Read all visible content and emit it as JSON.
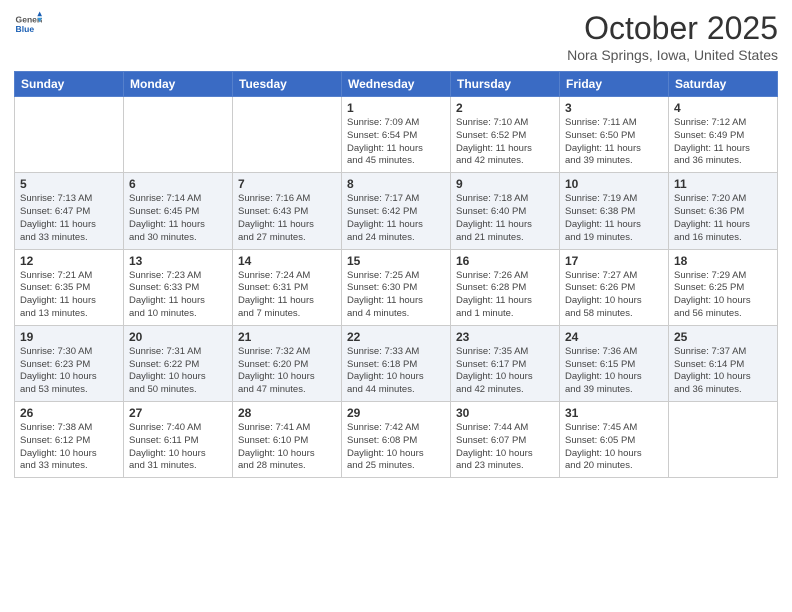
{
  "header": {
    "logo_general": "General",
    "logo_blue": "Blue",
    "month_title": "October 2025",
    "location": "Nora Springs, Iowa, United States"
  },
  "weekdays": [
    "Sunday",
    "Monday",
    "Tuesday",
    "Wednesday",
    "Thursday",
    "Friday",
    "Saturday"
  ],
  "weeks": [
    [
      {
        "day": "",
        "info": ""
      },
      {
        "day": "",
        "info": ""
      },
      {
        "day": "",
        "info": ""
      },
      {
        "day": "1",
        "info": "Sunrise: 7:09 AM\nSunset: 6:54 PM\nDaylight: 11 hours\nand 45 minutes."
      },
      {
        "day": "2",
        "info": "Sunrise: 7:10 AM\nSunset: 6:52 PM\nDaylight: 11 hours\nand 42 minutes."
      },
      {
        "day": "3",
        "info": "Sunrise: 7:11 AM\nSunset: 6:50 PM\nDaylight: 11 hours\nand 39 minutes."
      },
      {
        "day": "4",
        "info": "Sunrise: 7:12 AM\nSunset: 6:49 PM\nDaylight: 11 hours\nand 36 minutes."
      }
    ],
    [
      {
        "day": "5",
        "info": "Sunrise: 7:13 AM\nSunset: 6:47 PM\nDaylight: 11 hours\nand 33 minutes."
      },
      {
        "day": "6",
        "info": "Sunrise: 7:14 AM\nSunset: 6:45 PM\nDaylight: 11 hours\nand 30 minutes."
      },
      {
        "day": "7",
        "info": "Sunrise: 7:16 AM\nSunset: 6:43 PM\nDaylight: 11 hours\nand 27 minutes."
      },
      {
        "day": "8",
        "info": "Sunrise: 7:17 AM\nSunset: 6:42 PM\nDaylight: 11 hours\nand 24 minutes."
      },
      {
        "day": "9",
        "info": "Sunrise: 7:18 AM\nSunset: 6:40 PM\nDaylight: 11 hours\nand 21 minutes."
      },
      {
        "day": "10",
        "info": "Sunrise: 7:19 AM\nSunset: 6:38 PM\nDaylight: 11 hours\nand 19 minutes."
      },
      {
        "day": "11",
        "info": "Sunrise: 7:20 AM\nSunset: 6:36 PM\nDaylight: 11 hours\nand 16 minutes."
      }
    ],
    [
      {
        "day": "12",
        "info": "Sunrise: 7:21 AM\nSunset: 6:35 PM\nDaylight: 11 hours\nand 13 minutes."
      },
      {
        "day": "13",
        "info": "Sunrise: 7:23 AM\nSunset: 6:33 PM\nDaylight: 11 hours\nand 10 minutes."
      },
      {
        "day": "14",
        "info": "Sunrise: 7:24 AM\nSunset: 6:31 PM\nDaylight: 11 hours\nand 7 minutes."
      },
      {
        "day": "15",
        "info": "Sunrise: 7:25 AM\nSunset: 6:30 PM\nDaylight: 11 hours\nand 4 minutes."
      },
      {
        "day": "16",
        "info": "Sunrise: 7:26 AM\nSunset: 6:28 PM\nDaylight: 11 hours\nand 1 minute."
      },
      {
        "day": "17",
        "info": "Sunrise: 7:27 AM\nSunset: 6:26 PM\nDaylight: 10 hours\nand 58 minutes."
      },
      {
        "day": "18",
        "info": "Sunrise: 7:29 AM\nSunset: 6:25 PM\nDaylight: 10 hours\nand 56 minutes."
      }
    ],
    [
      {
        "day": "19",
        "info": "Sunrise: 7:30 AM\nSunset: 6:23 PM\nDaylight: 10 hours\nand 53 minutes."
      },
      {
        "day": "20",
        "info": "Sunrise: 7:31 AM\nSunset: 6:22 PM\nDaylight: 10 hours\nand 50 minutes."
      },
      {
        "day": "21",
        "info": "Sunrise: 7:32 AM\nSunset: 6:20 PM\nDaylight: 10 hours\nand 47 minutes."
      },
      {
        "day": "22",
        "info": "Sunrise: 7:33 AM\nSunset: 6:18 PM\nDaylight: 10 hours\nand 44 minutes."
      },
      {
        "day": "23",
        "info": "Sunrise: 7:35 AM\nSunset: 6:17 PM\nDaylight: 10 hours\nand 42 minutes."
      },
      {
        "day": "24",
        "info": "Sunrise: 7:36 AM\nSunset: 6:15 PM\nDaylight: 10 hours\nand 39 minutes."
      },
      {
        "day": "25",
        "info": "Sunrise: 7:37 AM\nSunset: 6:14 PM\nDaylight: 10 hours\nand 36 minutes."
      }
    ],
    [
      {
        "day": "26",
        "info": "Sunrise: 7:38 AM\nSunset: 6:12 PM\nDaylight: 10 hours\nand 33 minutes."
      },
      {
        "day": "27",
        "info": "Sunrise: 7:40 AM\nSunset: 6:11 PM\nDaylight: 10 hours\nand 31 minutes."
      },
      {
        "day": "28",
        "info": "Sunrise: 7:41 AM\nSunset: 6:10 PM\nDaylight: 10 hours\nand 28 minutes."
      },
      {
        "day": "29",
        "info": "Sunrise: 7:42 AM\nSunset: 6:08 PM\nDaylight: 10 hours\nand 25 minutes."
      },
      {
        "day": "30",
        "info": "Sunrise: 7:44 AM\nSunset: 6:07 PM\nDaylight: 10 hours\nand 23 minutes."
      },
      {
        "day": "31",
        "info": "Sunrise: 7:45 AM\nSunset: 6:05 PM\nDaylight: 10 hours\nand 20 minutes."
      },
      {
        "day": "",
        "info": ""
      }
    ]
  ]
}
